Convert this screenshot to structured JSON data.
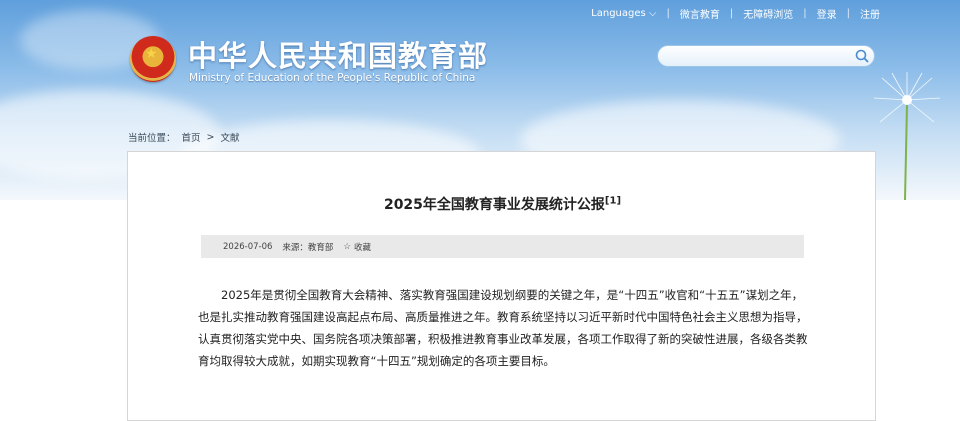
{
  "header": {
    "nav": [
      "Languages",
      "微言教育",
      "无障碍浏览",
      "登录",
      "注册"
    ],
    "title_cn": "中华人民共和国教育部",
    "title_en": "Ministry of Education of the People's Republic of China",
    "search": {
      "value": "",
      "placeholder": ""
    }
  },
  "breadcrumb": {
    "prefix": "当前位置：",
    "items": [
      "首页",
      "文献"
    ],
    "separator": ">"
  },
  "article": {
    "title": "2025年全国教育事业发展统计公报",
    "footnote": "[1]",
    "meta": {
      "date": "2026-07-06",
      "source": "来源：教育部",
      "favorite": "收藏"
    },
    "paragraph": "2025年是贯彻全国教育大会精神、落实教育强国建设规划纲要的关键之年，是“十四五”收官和“十五五”谋划之年，也是扎实推动教育强国建设高起点布局、高质量推进之年。教育系统坚持以习近平新时代中国特色社会主义思想为指导，认真贯彻落实党中央、国务院各项决策部署，积极推进教育事业改革发展，各项工作取得了新的突破性进展，各级各类教育均取得较大成就，如期实现教育“十四五”规划确定的各项主要目标。"
  },
  "colors": {
    "sky_top": "#5f9fdc",
    "emblem_red": "#d02a1c",
    "meta_bar": "#e9e9e9"
  }
}
